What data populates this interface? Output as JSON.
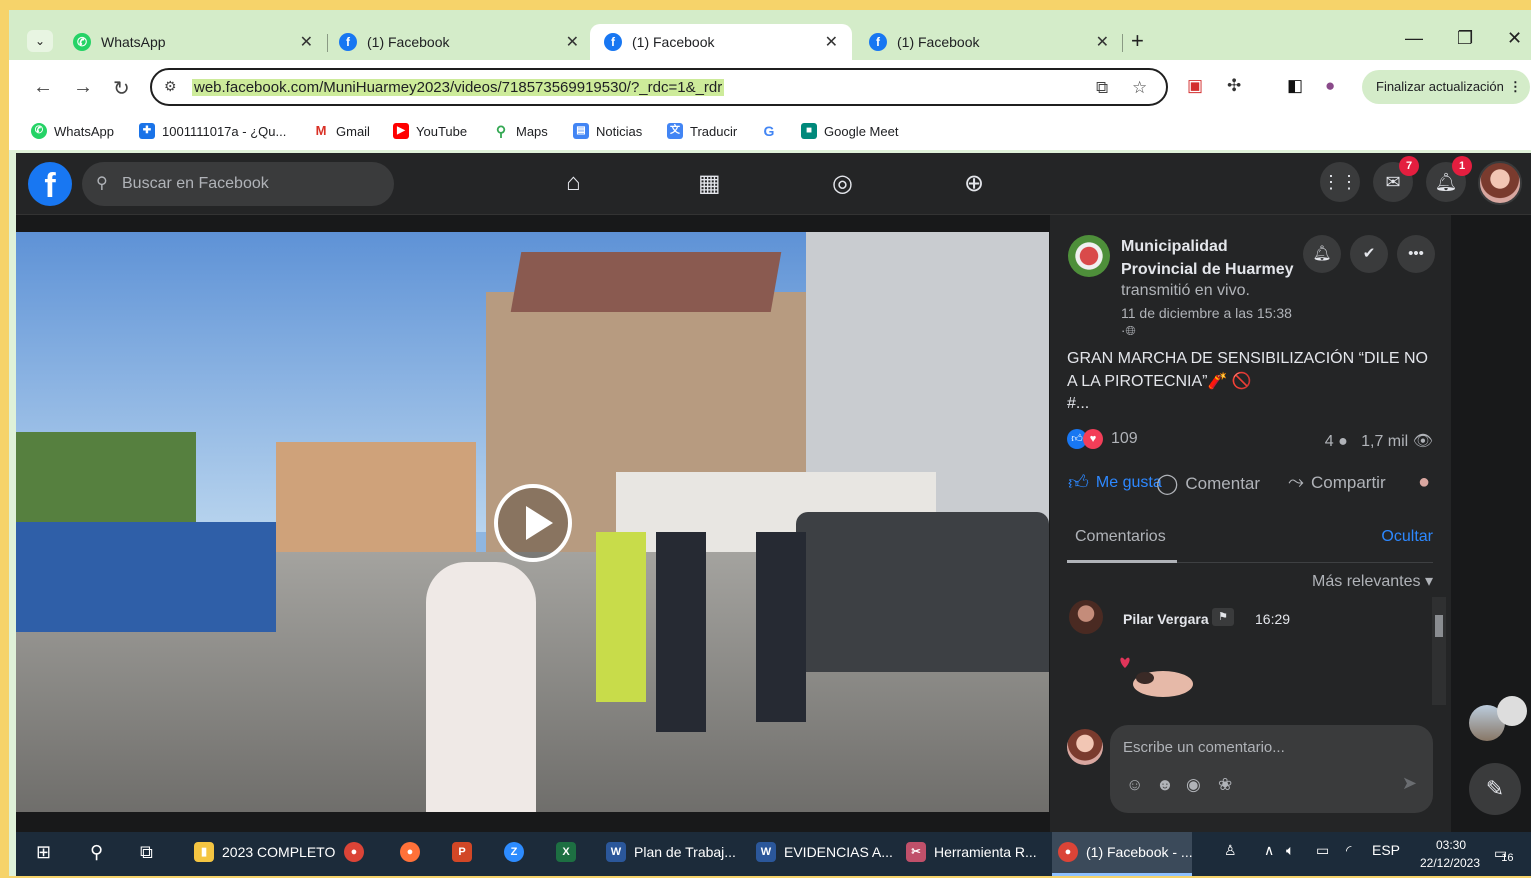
{
  "browser": {
    "tabs": [
      {
        "title": "WhatsApp",
        "favicon": "whatsapp-icon",
        "active": false
      },
      {
        "title": "(1) Facebook",
        "favicon": "facebook-icon",
        "active": false
      },
      {
        "title": "(1) Facebook",
        "favicon": "facebook-icon",
        "active": true
      },
      {
        "title": "(1) Facebook",
        "favicon": "facebook-icon",
        "active": false
      }
    ],
    "url": "web.facebook.com/MuniHuarmey2023/videos/718573569919530/?_rdc=1&_rdr",
    "update_button": "Finalizar actualización",
    "bookmarks": [
      {
        "label": "WhatsApp"
      },
      {
        "label": "1001111017a - ¿Qu..."
      },
      {
        "label": "Gmail"
      },
      {
        "label": "YouTube"
      },
      {
        "label": "Maps"
      },
      {
        "label": "Noticias"
      },
      {
        "label": "Traducir"
      },
      {
        "label": "Google Meet"
      }
    ]
  },
  "facebook": {
    "search_placeholder": "Buscar en Facebook",
    "messenger_badge": "7",
    "notifications_badge": "1",
    "post": {
      "page_name": "Municipalidad Provincial de Huarmey",
      "live_text": "transmitió en vivo.",
      "date": "11 de diciembre a las 15:38",
      "privacy": "·",
      "text": "GRAN MARCHA DE SENSIBILIZACIÓN “DILE NO A LA PIROTECNIA”🧨 🚫",
      "more": "#...",
      "reaction_count": "109",
      "comment_count": "4",
      "views": "1,7 mil",
      "like_label": "Me gusta",
      "comment_label": "Comentar",
      "share_label": "Compartir"
    },
    "comments": {
      "tab_label": "Comentarios",
      "hide_label": "Ocultar",
      "sort_label": "Más relevantes",
      "items": [
        {
          "author": "Pilar Vergara",
          "time": "16:29"
        }
      ],
      "input_placeholder": "Escribe un comentario..."
    }
  },
  "taskbar": {
    "items": [
      {
        "label": "2023 COMPLETO"
      },
      {
        "label": "Plan de Trabaj..."
      },
      {
        "label": "EVIDENCIAS A..."
      },
      {
        "label": "Herramienta R..."
      },
      {
        "label": "(1) Facebook - ..."
      }
    ],
    "language": "ESP",
    "time": "03:30",
    "date": "22/12/2023",
    "notification_count": "16"
  },
  "colors": {
    "facebook_blue": "#1877f2",
    "link_blue": "#2d88ff",
    "badge_red": "#e41e3f",
    "chrome_green": "#d4ecc9"
  }
}
